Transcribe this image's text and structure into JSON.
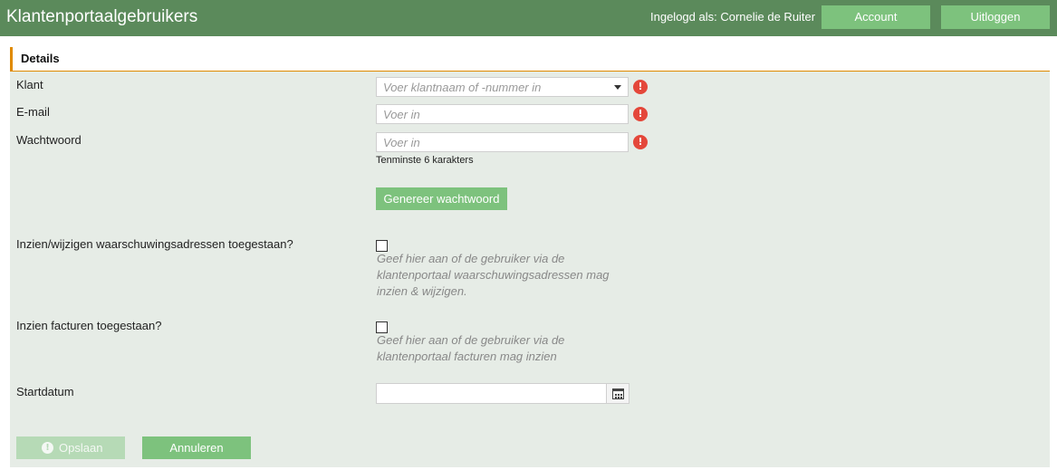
{
  "header": {
    "title": "Klantenportaalgebruikers",
    "logged_in_text": "Ingelogd als: Cornelie de Ruiter",
    "account_label": "Account",
    "logout_label": "Uitloggen",
    "background_color": "#5b8a5b",
    "button_color": "#7dc27d"
  },
  "section": {
    "title": "Details",
    "accent_color": "#e08a00"
  },
  "form": {
    "klant": {
      "label": "Klant",
      "placeholder": "Voer klantnaam of -nummer in",
      "warning_icon": "exclamation-circle-icon"
    },
    "email": {
      "label": "E-mail",
      "placeholder": "Voer in",
      "warning_icon": "exclamation-circle-icon"
    },
    "wachtwoord": {
      "label": "Wachtwoord",
      "placeholder": "Voer in",
      "hint": "Tenminste 6 karakters",
      "warning_icon": "exclamation-circle-icon"
    },
    "generate_button_label": "Genereer wachtwoord",
    "warnings_permission": {
      "label": "Inzien/wijzigen waarschuwingsadressen toegestaan?",
      "help": "Geef hier aan of de gebruiker via de klantenportaal waarschuwingsadressen mag inzien & wijzigen.",
      "checked": false
    },
    "invoices_permission": {
      "label": "Inzien facturen toegestaan?",
      "help": "Geef hier aan of de gebruiker via de klantenportaal facturen mag inzien",
      "checked": false
    },
    "startdatum": {
      "label": "Startdatum",
      "value": "",
      "calendar_icon": "calendar-icon"
    }
  },
  "actions": {
    "save_label": "Opslaan",
    "cancel_label": "Annuleren"
  }
}
